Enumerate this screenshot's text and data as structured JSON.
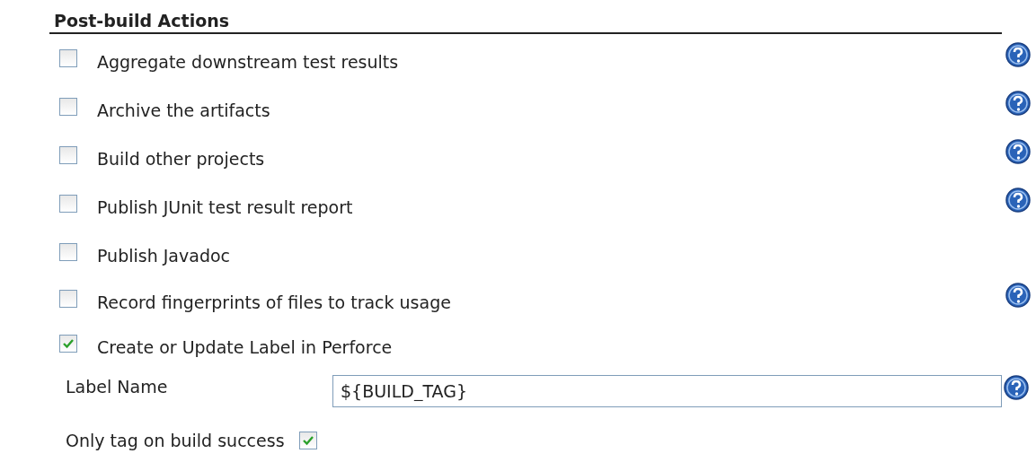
{
  "section": {
    "title": "Post-build Actions"
  },
  "actions": [
    {
      "label": "Aggregate downstream test results",
      "checked": false,
      "help": true
    },
    {
      "label": "Archive the artifacts",
      "checked": false,
      "help": true
    },
    {
      "label": "Build other projects",
      "checked": false,
      "help": true
    },
    {
      "label": "Publish JUnit test result report",
      "checked": false,
      "help": true
    },
    {
      "label": "Publish Javadoc",
      "checked": false,
      "help": false
    },
    {
      "label": "Record fingerprints of files to track usage",
      "checked": false,
      "help": true
    },
    {
      "label": "Create or Update Label in Perforce",
      "checked": true,
      "help": false
    }
  ],
  "label_name": {
    "label": "Label Name",
    "value": "${BUILD_TAG}",
    "help": true
  },
  "only_tag": {
    "label": "Only tag on build success",
    "checked": true
  }
}
